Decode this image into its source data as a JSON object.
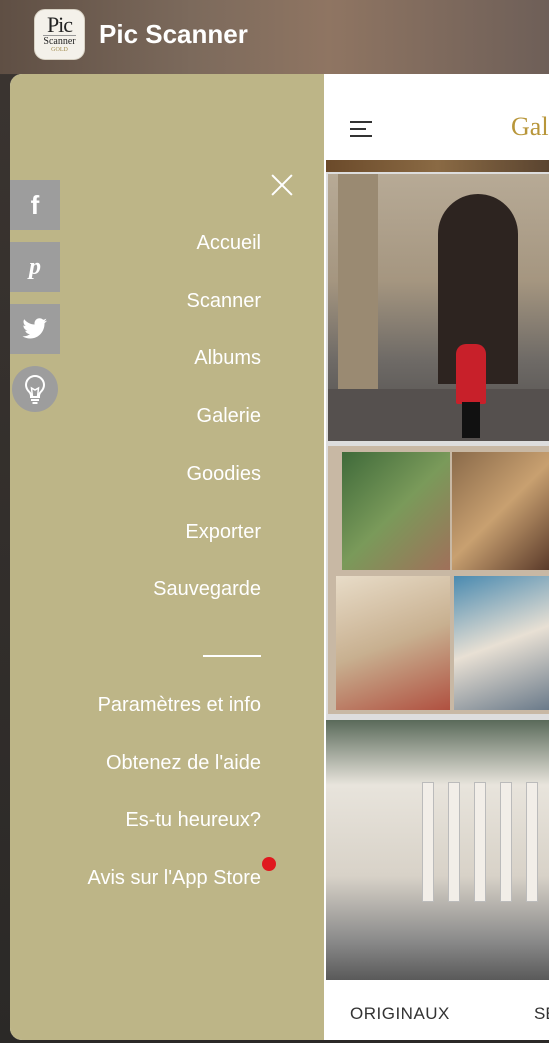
{
  "header": {
    "app_title": "Pic Scanner",
    "icon_text_top": "Pic",
    "icon_text_mid": "Scanner",
    "icon_text_bottom": "GOLD"
  },
  "content": {
    "title": "Gale",
    "tabs": {
      "originals": "ORIGINAUX",
      "second": "SE"
    }
  },
  "drawer": {
    "menu": [
      {
        "label": "Accueil"
      },
      {
        "label": "Scanner"
      },
      {
        "label": "Albums"
      },
      {
        "label": "Galerie"
      },
      {
        "label": "Goodies"
      },
      {
        "label": "Exporter"
      },
      {
        "label": "Sauvegarde"
      }
    ],
    "secondary": [
      {
        "label": "Paramètres et info"
      },
      {
        "label": "Obtenez de l'aide"
      },
      {
        "label": "Es-tu heureux?"
      },
      {
        "label": "Avis sur l'App Store"
      }
    ],
    "social": {
      "facebook": "f",
      "pinterest": "p"
    }
  },
  "colors": {
    "drawer_bg": "#bdb587",
    "accent_gold": "#b8963a",
    "notification": "#e0181e",
    "social_bg": "#9d9d9d"
  },
  "icons": {
    "close": "close-icon",
    "hamburger": "hamburger-menu-icon",
    "facebook": "facebook-icon",
    "pinterest": "pinterest-icon",
    "twitter": "twitter-icon",
    "bulb": "lightbulb-icon"
  }
}
